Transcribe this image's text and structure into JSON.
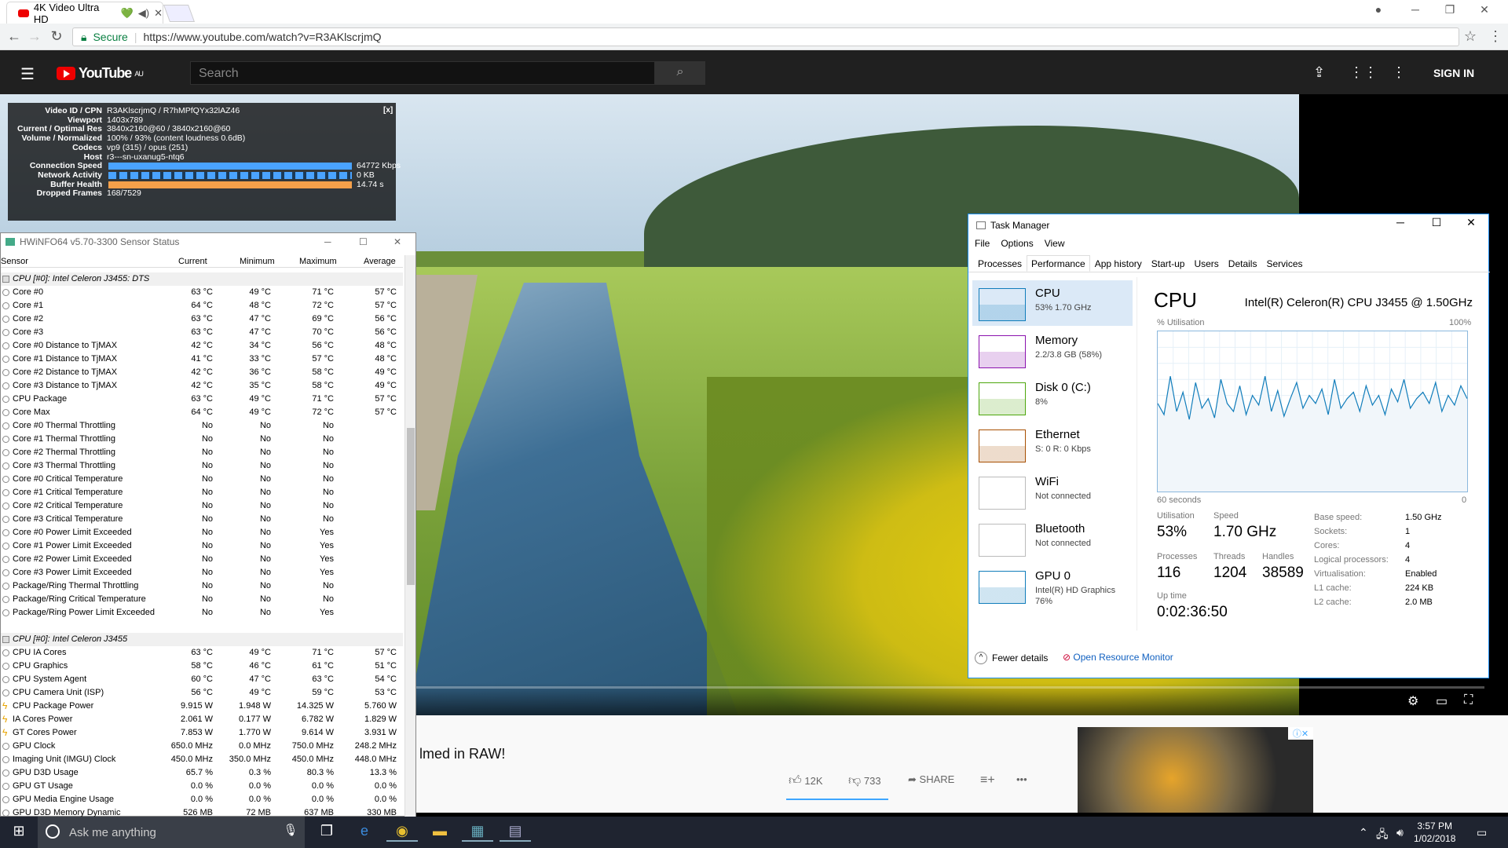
{
  "browser": {
    "tab_title": "4K Video Ultra HD",
    "tab_emoji": "💚",
    "url_secure_label": "Secure",
    "url": "https://www.youtube.com/watch?v=R3AKlscrjmQ"
  },
  "youtube": {
    "logo_text": "YouTube",
    "logo_region": "AU",
    "search_placeholder": "Search",
    "sign_in": "SIGN IN",
    "video_title_fragment": "lmed in RAW!",
    "likes": "12K",
    "dislikes": "733",
    "share": "SHARE",
    "more": "•••"
  },
  "stats": {
    "rows": [
      {
        "label": "Video ID / CPN",
        "value": "R3AKlscrjmQ / R7hMPfQYx32lAZ46"
      },
      {
        "label": "Viewport",
        "value": "1403x789"
      },
      {
        "label": "Current / Optimal Res",
        "value": "3840x2160@60 / 3840x2160@60"
      },
      {
        "label": "Volume / Normalized",
        "value": "100% / 93% (content loudness 0.6dB)"
      },
      {
        "label": "Codecs",
        "value": "vp9 (315) / opus (251)"
      },
      {
        "label": "Host",
        "value": "r3---sn-uxanug5-ntq6"
      },
      {
        "label": "Connection Speed",
        "value": "64772 Kbps"
      },
      {
        "label": "Network Activity",
        "value": "0 KB"
      },
      {
        "label": "Buffer Health",
        "value": "14.74 s"
      },
      {
        "label": "Dropped Frames",
        "value": "168/7529"
      }
    ],
    "close": "[x]"
  },
  "hwinfo": {
    "title": "HWiNFO64 v5.70-3300 Sensor Status",
    "headers": [
      "Sensor",
      "Current",
      "Minimum",
      "Maximum",
      "Average"
    ],
    "groups": [
      {
        "name": "CPU [#0]: Intel Celeron J3455: DTS",
        "rows": [
          {
            "n": "Core #0",
            "c": "63 °C",
            "mn": "49 °C",
            "mx": "71 °C",
            "a": "57 °C",
            "i": "c"
          },
          {
            "n": "Core #1",
            "c": "64 °C",
            "mn": "48 °C",
            "mx": "72 °C",
            "a": "57 °C",
            "i": "c"
          },
          {
            "n": "Core #2",
            "c": "63 °C",
            "mn": "47 °C",
            "mx": "69 °C",
            "a": "56 °C",
            "i": "c"
          },
          {
            "n": "Core #3",
            "c": "63 °C",
            "mn": "47 °C",
            "mx": "70 °C",
            "a": "56 °C",
            "i": "c"
          },
          {
            "n": "Core #0 Distance to TjMAX",
            "c": "42 °C",
            "mn": "34 °C",
            "mx": "56 °C",
            "a": "48 °C",
            "i": "c"
          },
          {
            "n": "Core #1 Distance to TjMAX",
            "c": "41 °C",
            "mn": "33 °C",
            "mx": "57 °C",
            "a": "48 °C",
            "i": "c"
          },
          {
            "n": "Core #2 Distance to TjMAX",
            "c": "42 °C",
            "mn": "36 °C",
            "mx": "58 °C",
            "a": "49 °C",
            "i": "c"
          },
          {
            "n": "Core #3 Distance to TjMAX",
            "c": "42 °C",
            "mn": "35 °C",
            "mx": "58 °C",
            "a": "49 °C",
            "i": "c"
          },
          {
            "n": "CPU Package",
            "c": "63 °C",
            "mn": "49 °C",
            "mx": "71 °C",
            "a": "57 °C",
            "i": "c"
          },
          {
            "n": "Core Max",
            "c": "64 °C",
            "mn": "49 °C",
            "mx": "72 °C",
            "a": "57 °C",
            "i": "c"
          },
          {
            "n": "Core #0 Thermal Throttling",
            "c": "No",
            "mn": "No",
            "mx": "No",
            "a": "",
            "i": "o"
          },
          {
            "n": "Core #1 Thermal Throttling",
            "c": "No",
            "mn": "No",
            "mx": "No",
            "a": "",
            "i": "o"
          },
          {
            "n": "Core #2 Thermal Throttling",
            "c": "No",
            "mn": "No",
            "mx": "No",
            "a": "",
            "i": "o"
          },
          {
            "n": "Core #3 Thermal Throttling",
            "c": "No",
            "mn": "No",
            "mx": "No",
            "a": "",
            "i": "o"
          },
          {
            "n": "Core #0 Critical Temperature",
            "c": "No",
            "mn": "No",
            "mx": "No",
            "a": "",
            "i": "o"
          },
          {
            "n": "Core #1 Critical Temperature",
            "c": "No",
            "mn": "No",
            "mx": "No",
            "a": "",
            "i": "o"
          },
          {
            "n": "Core #2 Critical Temperature",
            "c": "No",
            "mn": "No",
            "mx": "No",
            "a": "",
            "i": "o"
          },
          {
            "n": "Core #3 Critical Temperature",
            "c": "No",
            "mn": "No",
            "mx": "No",
            "a": "",
            "i": "o"
          },
          {
            "n": "Core #0 Power Limit Exceeded",
            "c": "No",
            "mn": "No",
            "mx": "Yes",
            "a": "",
            "i": "o"
          },
          {
            "n": "Core #1 Power Limit Exceeded",
            "c": "No",
            "mn": "No",
            "mx": "Yes",
            "a": "",
            "i": "o"
          },
          {
            "n": "Core #2 Power Limit Exceeded",
            "c": "No",
            "mn": "No",
            "mx": "Yes",
            "a": "",
            "i": "o"
          },
          {
            "n": "Core #3 Power Limit Exceeded",
            "c": "No",
            "mn": "No",
            "mx": "Yes",
            "a": "",
            "i": "o"
          },
          {
            "n": "Package/Ring Thermal Throttling",
            "c": "No",
            "mn": "No",
            "mx": "No",
            "a": "",
            "i": "o"
          },
          {
            "n": "Package/Ring Critical Temperature",
            "c": "No",
            "mn": "No",
            "mx": "No",
            "a": "",
            "i": "o"
          },
          {
            "n": "Package/Ring Power Limit Exceeded",
            "c": "No",
            "mn": "No",
            "mx": "Yes",
            "a": "",
            "i": "o"
          }
        ]
      },
      {
        "name": "CPU [#0]: Intel Celeron J3455",
        "rows": [
          {
            "n": "CPU IA Cores",
            "c": "63 °C",
            "mn": "49 °C",
            "mx": "71 °C",
            "a": "57 °C",
            "i": "c"
          },
          {
            "n": "CPU Graphics",
            "c": "58 °C",
            "mn": "46 °C",
            "mx": "61 °C",
            "a": "51 °C",
            "i": "c"
          },
          {
            "n": "CPU System Agent",
            "c": "60 °C",
            "mn": "47 °C",
            "mx": "63 °C",
            "a": "54 °C",
            "i": "c"
          },
          {
            "n": "CPU Camera Unit (ISP)",
            "c": "56 °C",
            "mn": "49 °C",
            "mx": "59 °C",
            "a": "53 °C",
            "i": "c"
          },
          {
            "n": "CPU Package Power",
            "c": "9.915 W",
            "mn": "1.948 W",
            "mx": "14.325 W",
            "a": "5.760 W",
            "i": "b"
          },
          {
            "n": "IA Cores Power",
            "c": "2.061 W",
            "mn": "0.177 W",
            "mx": "6.782 W",
            "a": "1.829 W",
            "i": "b"
          },
          {
            "n": "GT Cores Power",
            "c": "7.853 W",
            "mn": "1.770 W",
            "mx": "9.614 W",
            "a": "3.931 W",
            "i": "b"
          },
          {
            "n": "GPU Clock",
            "c": "650.0 MHz",
            "mn": "0.0 MHz",
            "mx": "750.0 MHz",
            "a": "248.2 MHz",
            "i": "o"
          },
          {
            "n": "Imaging Unit (IMGU) Clock",
            "c": "450.0 MHz",
            "mn": "350.0 MHz",
            "mx": "450.0 MHz",
            "a": "448.0 MHz",
            "i": "o"
          },
          {
            "n": "GPU D3D Usage",
            "c": "65.7 %",
            "mn": "0.3 %",
            "mx": "80.3 %",
            "a": "13.3 %",
            "i": "o"
          },
          {
            "n": "GPU GT Usage",
            "c": "0.0 %",
            "mn": "0.0 %",
            "mx": "0.0 %",
            "a": "0.0 %",
            "i": "o"
          },
          {
            "n": "GPU Media Engine Usage",
            "c": "0.0 %",
            "mn": "0.0 %",
            "mx": "0.0 %",
            "a": "0.0 %",
            "i": "o"
          },
          {
            "n": "GPU D3D Memory Dynamic",
            "c": "526 MB",
            "mn": "72 MB",
            "mx": "637 MB",
            "a": "330 MB",
            "i": "o"
          }
        ]
      }
    ]
  },
  "taskmanager": {
    "title": "Task Manager",
    "menu": [
      "File",
      "Options",
      "View"
    ],
    "tabs": [
      "Processes",
      "Performance",
      "App history",
      "Start-up",
      "Users",
      "Details",
      "Services"
    ],
    "active_tab": "Performance",
    "sidebar": [
      {
        "name": "CPU",
        "sub1": "53%  1.70 GHz",
        "sub2": "",
        "color": "#117dbb"
      },
      {
        "name": "Memory",
        "sub1": "2.2/3.8 GB (58%)",
        "sub2": "",
        "color": "#8b12ae"
      },
      {
        "name": "Disk 0 (C:)",
        "sub1": "8%",
        "sub2": "",
        "color": "#4da60c"
      },
      {
        "name": "Ethernet",
        "sub1": "S: 0  R: 0 Kbps",
        "sub2": "",
        "color": "#a74f01"
      },
      {
        "name": "WiFi",
        "sub1": "Not connected",
        "sub2": "",
        "color": "#bbbbbb"
      },
      {
        "name": "Bluetooth",
        "sub1": "Not connected",
        "sub2": "",
        "color": "#bbbbbb"
      },
      {
        "name": "GPU 0",
        "sub1": "Intel(R) HD Graphics",
        "sub2": "76%",
        "color": "#117dbb"
      }
    ],
    "cpu_header": "CPU",
    "cpu_model": "Intel(R) Celeron(R) CPU J3455 @ 1.50GHz",
    "graph_label": "% Utilisation",
    "graph_max": "100%",
    "graph_time": "60 seconds",
    "graph_min": "0",
    "graph_values": [
      55,
      48,
      72,
      50,
      62,
      45,
      68,
      52,
      58,
      46,
      70,
      55,
      50,
      66,
      48,
      60,
      54,
      72,
      50,
      63,
      47,
      58,
      68,
      52,
      60,
      55,
      64,
      48,
      70,
      52,
      58,
      62,
      50,
      66,
      54,
      60,
      48,
      64,
      56,
      70,
      52,
      58,
      62,
      55,
      68,
      50,
      60,
      54,
      66,
      58
    ],
    "stats": {
      "utilisation_label": "Utilisation",
      "utilisation": "53%",
      "speed_label": "Speed",
      "speed": "1.70 GHz",
      "processes_label": "Processes",
      "processes": "116",
      "threads_label": "Threads",
      "threads": "1204",
      "handles_label": "Handles",
      "handles": "38589",
      "uptime_label": "Up time",
      "uptime": "0:02:36:50"
    },
    "specs": [
      {
        "k": "Base speed:",
        "v": "1.50 GHz"
      },
      {
        "k": "Sockets:",
        "v": "1"
      },
      {
        "k": "Cores:",
        "v": "4"
      },
      {
        "k": "Logical processors:",
        "v": "4"
      },
      {
        "k": "Virtualisation:",
        "v": "Enabled"
      },
      {
        "k": "L1 cache:",
        "v": "224 KB"
      },
      {
        "k": "L2 cache:",
        "v": "2.0 MB"
      }
    ],
    "fewer_details": "Fewer details",
    "open_resmon": "Open Resource Monitor"
  },
  "taskbar": {
    "search_placeholder": "Ask me anything",
    "time": "3:57 PM",
    "date": "1/02/2018"
  }
}
